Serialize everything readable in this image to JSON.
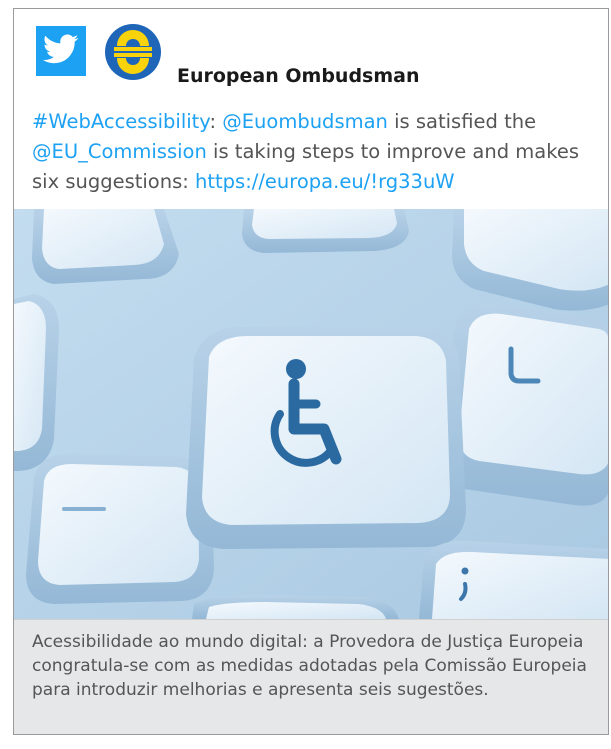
{
  "account": {
    "name": "European Ombudsman"
  },
  "tweet": {
    "hashtag": "#WebAccessibility",
    "colon": ": ",
    "mention1": "@Euombudsman",
    "text1": " is satisfied the ",
    "mention2": "@EU_Commission",
    "text2": " is taking steps to improve and makes six suggestions: ",
    "link": "https://europa.eu/!rg33uW"
  },
  "image": {
    "key_letter": "L",
    "key_punct": ";",
    "accessibility_symbol": "wheelchair-icon"
  },
  "caption": "Acessibilidade ao mundo digital: a Provedora de Justiça Europeia congratula-se com as medidas adotadas pela Comissão Europeia para introduzir melhorias e apresenta seis sugestões.",
  "colors": {
    "twitter_blue": "#1da1f2",
    "eo_blue": "#1f66b8",
    "eo_yellow": "#f8d30c",
    "key_icon": "#2a6aa0",
    "footer_bg": "#e6e7e8"
  }
}
